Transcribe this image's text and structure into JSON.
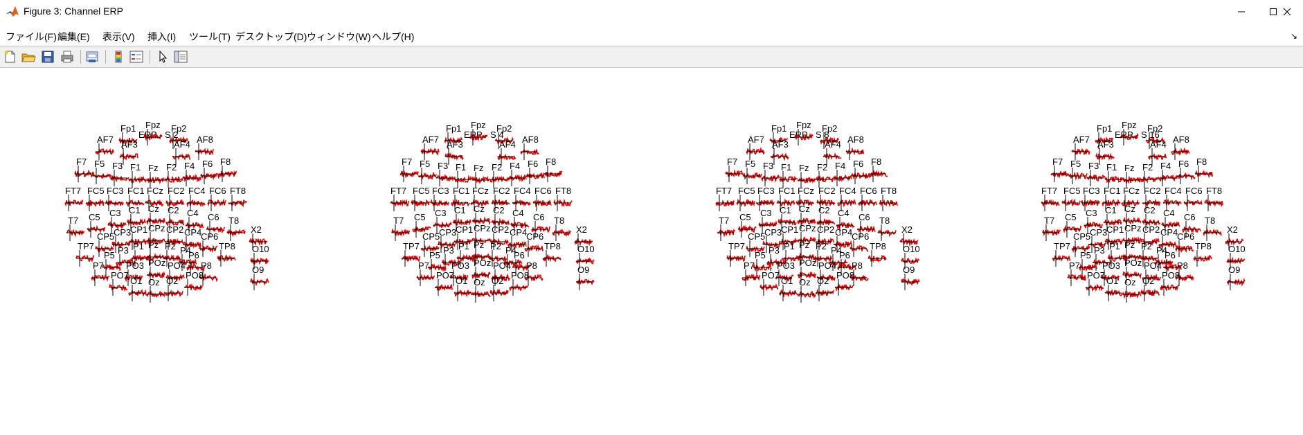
{
  "window": {
    "title": "Figure 3: Channel ERP",
    "app_icon": "matlab-icon",
    "controls": [
      "minimize-icon",
      "maximize-icon",
      "close-icon"
    ]
  },
  "menu": {
    "items": [
      "ファイル(F)",
      "編集(E)",
      "表示(V)",
      "挿入(I)",
      "ツール(T)",
      "デスクトップ(D)",
      "ウィンドウ(W)",
      "ヘルプ(H)"
    ],
    "dock_arrow": "↘"
  },
  "toolbar": {
    "buttons": [
      "new-figure-icon",
      "open-icon",
      "save-icon",
      "print-icon",
      "print-preview-icon",
      "colorbar-icon",
      "legend-icon",
      "pointer-icon",
      "property-editor-icon"
    ]
  },
  "colors": {
    "trace": "#e00000",
    "axis": "#000000"
  },
  "panels": [
    {
      "title": "ERP - S  2"
    },
    {
      "title": "ERP - S  4"
    },
    {
      "title": "ERP - S  8"
    },
    {
      "title": "ERP - S  16"
    }
  ],
  "electrodes": [
    "Fp1",
    "Fpz",
    "Fp2",
    "AF7",
    "AF3",
    "AF4",
    "AF8",
    "F7",
    "F5",
    "F3",
    "F1",
    "Fz",
    "F2",
    "F4",
    "F6",
    "F8",
    "FT7",
    "FC5",
    "FC3",
    "FC1",
    "FCz",
    "FC2",
    "FC4",
    "FC6",
    "FT8",
    "T7",
    "C5",
    "C3",
    "C1",
    "Cz",
    "C2",
    "C4",
    "C6",
    "T8",
    "CP5",
    "CP3",
    "CP1",
    "CPz",
    "CP2",
    "CP4",
    "CP6",
    "TP7",
    "P3",
    "P1",
    "Pz",
    "P2",
    "P4",
    "TP8",
    "P5",
    "P6",
    "P7",
    "PO3",
    "POz",
    "PO4",
    "P8",
    "PO7",
    "O1",
    "Oz",
    "O2",
    "PO8",
    "X2",
    "O10",
    "O9"
  ]
}
